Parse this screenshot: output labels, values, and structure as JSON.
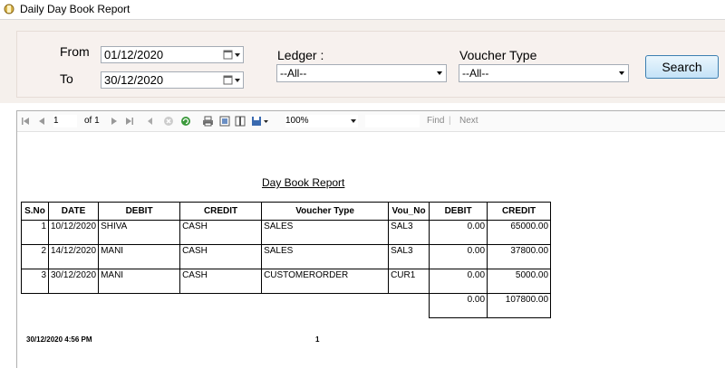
{
  "window": {
    "title": "Daily Day Book Report"
  },
  "filters": {
    "from_label": "From",
    "from_value": "01/12/2020",
    "to_label": "To",
    "to_value": "30/12/2020",
    "ledger_label": "Ledger :",
    "ledger_value": "--All--",
    "voucher_type_label": "Voucher Type",
    "voucher_type_value": "--All--",
    "search_label": "Search"
  },
  "toolbar": {
    "page_current": "1",
    "page_of": "of 1",
    "zoom": "100%",
    "find_label": "Find",
    "next_label": "Next"
  },
  "report": {
    "title": "Day Book Report",
    "headers": [
      "S.No",
      "DATE",
      "DEBIT",
      "CREDIT",
      "Voucher Type",
      "Vou_No",
      "DEBIT",
      "CREDIT"
    ],
    "rows": [
      [
        "1",
        "10/12/2020",
        "SHIVA",
        "CASH",
        "SALES",
        "SAL3",
        "0.00",
        "65000.00"
      ],
      [
        "2",
        "14/12/2020",
        "MANI",
        "CASH",
        "SALES",
        "SAL3",
        "0.00",
        "37800.00"
      ],
      [
        "3",
        "30/12/2020",
        "MANI",
        "CASH",
        "CUSTOMERORDER",
        "CUR1",
        "0.00",
        "5000.00"
      ]
    ],
    "totals": {
      "debit": "0.00",
      "credit": "107800.00"
    },
    "footer_datetime": "30/12/2020 4:56 PM",
    "footer_page": "1"
  }
}
